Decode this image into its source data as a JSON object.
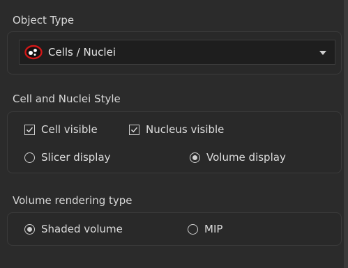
{
  "object_type": {
    "title": "Object Type",
    "combo_value": "Cells / Nuclei",
    "combo_icon": "cells-nuclei-icon"
  },
  "cell_nuclei_style": {
    "title": "Cell and Nuclei Style",
    "cell_visible": {
      "label": "Cell visible",
      "checked": true
    },
    "nucleus_visible": {
      "label": "Nucleus visible",
      "checked": true
    },
    "slicer_display": {
      "label": "Slicer display",
      "selected": false
    },
    "volume_display": {
      "label": "Volume display",
      "selected": true
    }
  },
  "volume_rendering": {
    "title": "Volume rendering type",
    "shaded_volume": {
      "label": "Shaded volume",
      "selected": true
    },
    "mip": {
      "label": "MIP",
      "selected": false
    }
  },
  "colors": {
    "background": "#2b2b2b",
    "text": "#dcdcdc",
    "icon_red": "#d01818"
  }
}
